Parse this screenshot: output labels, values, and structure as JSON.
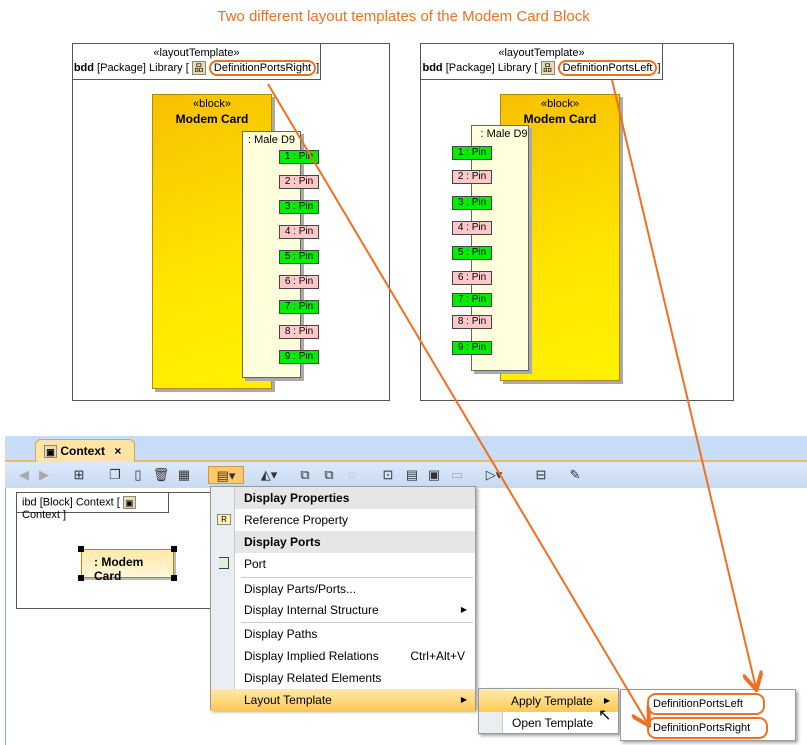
{
  "title": "Two different layout templates of the Modem Card Block",
  "left_diagram": {
    "stereotype": "«layoutTemplate»",
    "kind": "bdd",
    "type": "[Package]",
    "owner": "Library [",
    "name": "DefinitionPortsRight",
    "close": "]",
    "block_stereotype": "«block»",
    "block_name": "Modem Card",
    "part_name": ": Male D9",
    "pins": [
      "1 : Pin",
      "2 : Pin",
      "3 : Pin",
      "4 : Pin",
      "5 : Pin",
      "6 : Pin",
      "7 : Pin",
      "8 : Pin",
      "9 : Pin"
    ]
  },
  "right_diagram": {
    "stereotype": "«layoutTemplate»",
    "kind": "bdd",
    "type": "[Package]",
    "owner": "Library [",
    "name": "DefinitionPortsLeft",
    "close": "]",
    "block_stereotype": "«block»",
    "block_name": "Modem Card",
    "part_name": ": Male D9",
    "pins": [
      "1 : Pin",
      "2 : Pin",
      "3 : Pin",
      "4 : Pin",
      "5 : Pin",
      "6 : Pin",
      "7 : Pin",
      "8 : Pin",
      "9 : Pin"
    ]
  },
  "tab": {
    "label": "Context",
    "close": "×"
  },
  "ibd": {
    "kind": "ibd",
    "type": "[Block]",
    "owner": "Context [",
    "name": "Context",
    "close": "]",
    "part": ": Modem Card"
  },
  "menu": {
    "display_properties": "Display Properties",
    "reference_property": "Reference Property",
    "display_ports": "Display Ports",
    "port": "Port",
    "display_parts_ports": "Display Parts/Ports...",
    "display_internal_structure": "Display Internal Structure",
    "display_paths": "Display Paths",
    "display_implied_relations": "Display Implied Relations",
    "implied_shortcut": "Ctrl+Alt+V",
    "display_related_elements": "Display Related Elements",
    "layout_template": "Layout Template"
  },
  "submenu": {
    "apply_template": "Apply Template",
    "open_template": "Open Template"
  },
  "templates": [
    "DefinitionPortsLeft",
    "DefinitionPortsRight"
  ],
  "colors": {
    "accent": "#f07020",
    "pin_green": "#00ee00",
    "pin_pink": "#ffc8c8"
  }
}
